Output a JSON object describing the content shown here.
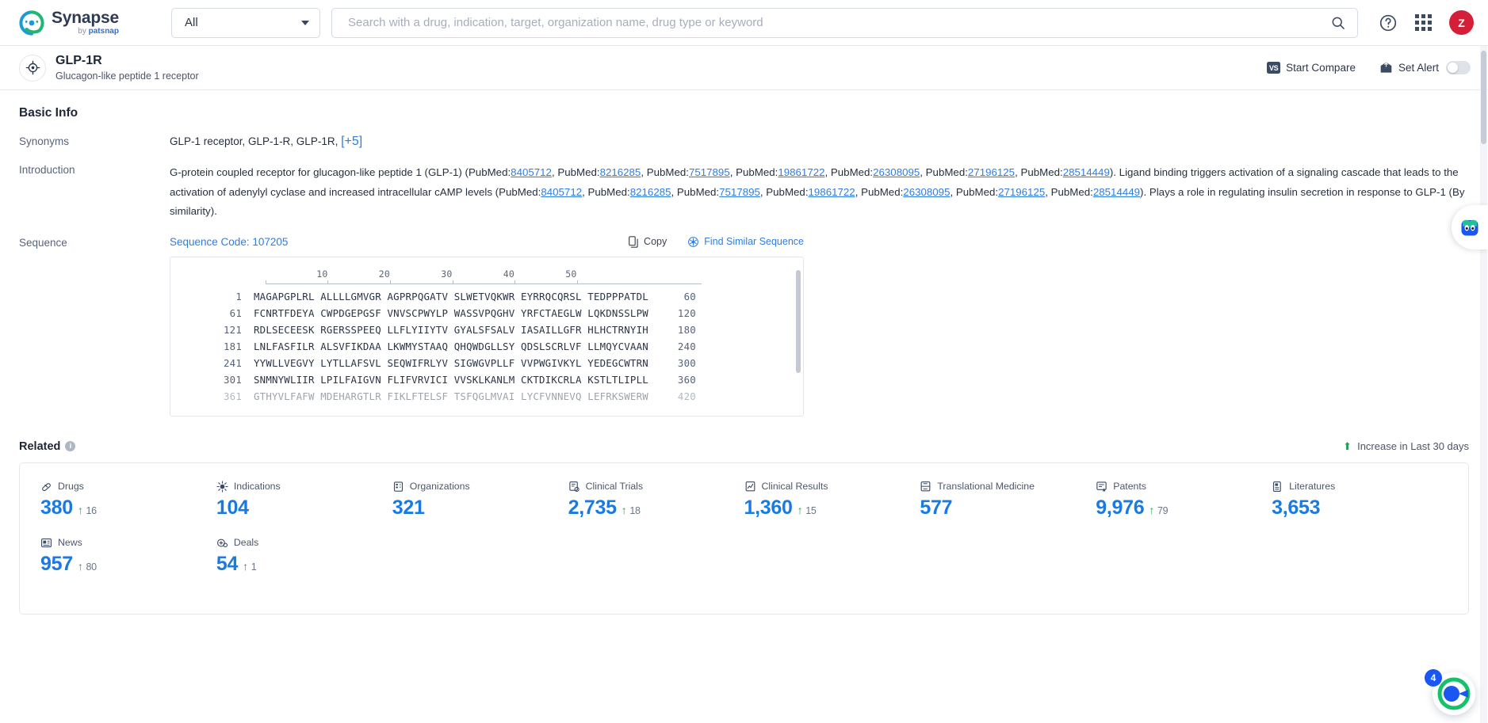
{
  "topbar": {
    "brand_name": "Synapse",
    "brand_sub_prefix": "by ",
    "brand_sub_name": "patsnap",
    "scope_value": "All",
    "scope_icon": "chevron-down-icon",
    "search_value": "",
    "search_placeholder": "Search with a drug, indication, target, organization name, drug type or keyword",
    "search_icon": "search-icon",
    "help_icon": "help-circle-icon",
    "apps_icon": "grid-apps-icon",
    "avatar_initial": "Z",
    "avatar_color": "#d31f38"
  },
  "entity": {
    "icon": "target-crosshair-icon",
    "name": "GLP-1R",
    "subtitle": "Glucagon-like peptide 1 receptor",
    "compare_badge": "VS",
    "compare_label": "Start Compare",
    "alert_icon": "bell-envelope-icon",
    "alert_label": "Set Alert",
    "alert_toggle_on": false
  },
  "basic_info": {
    "title": "Basic Info",
    "synonyms_label": "Synonyms",
    "synonyms": [
      "GLP-1 receptor",
      "GLP-1-R",
      "GLP-1R"
    ],
    "synonyms_more": "[+5]",
    "introduction_label": "Introduction",
    "introduction": {
      "part1": "G-protein coupled receptor for glucagon-like peptide 1 (GLP-1) (PubMed:",
      "refs1": [
        "8405712",
        "8216285",
        "7517895",
        "19861722",
        "26308095",
        "27196125",
        "28514449"
      ],
      "part2": "). Ligand binding triggers activation of a signaling cascade that leads to the activation of adenylyl cyclase and increased intracellular cAMP levels (PubMed:",
      "refs2": [
        "8405712",
        "8216285",
        "7517895",
        "19861722",
        "26308095",
        "27196125",
        "28514449"
      ],
      "part3": "). Plays a role in regulating insulin secretion in response to GLP-1 (By similarity).",
      "separator": ", PubMed:"
    }
  },
  "sequence": {
    "label": "Sequence",
    "code_label": "Sequence Code: 107205",
    "copy_label": "Copy",
    "copy_icon": "copy-icon",
    "similar_label": "Find Similar Sequence",
    "similar_icon": "find-similar-icon",
    "ruler_ticks": [
      "10",
      "20",
      "30",
      "40",
      "50"
    ],
    "rows": [
      {
        "start": "1",
        "blocks": [
          "MAGAPGPLRL",
          "ALLLLGMVGR",
          "AGPRPQGATV",
          "SLWETVQKWR",
          "EYRRQCQRSL",
          "TEDPPPATDL"
        ],
        "end": "60"
      },
      {
        "start": "61",
        "blocks": [
          "FCNRTFDEYA",
          "CWPDGEPGSF",
          "VNVSCPWYLP",
          "WASSVPQGHV",
          "YRFCTAEGLW",
          "LQKDNSSLPW"
        ],
        "end": "120"
      },
      {
        "start": "121",
        "blocks": [
          "RDLSECEESK",
          "RGERSSPEEQ",
          "LLFLYIIYTV",
          "GYALSFSALV",
          "IASAILLGFR",
          "HLHCTRNYIH"
        ],
        "end": "180"
      },
      {
        "start": "181",
        "blocks": [
          "LNLFASFILR",
          "ALSVFIKDAA",
          "LKWMYSTAAQ",
          "QHQWDGLLSY",
          "QDSLSCRLVF",
          "LLMQYCVAAN"
        ],
        "end": "240"
      },
      {
        "start": "241",
        "blocks": [
          "YYWLLVEGVY",
          "LYTLLAFSVL",
          "SEQWIFRLYV",
          "SIGWGVPLLF",
          "VVPWGIVKYL",
          "YEDEGCWTRN"
        ],
        "end": "300"
      },
      {
        "start": "301",
        "blocks": [
          "SNMNYWLIIR",
          "LPILFAIGVN",
          "FLIFVRVICI",
          "VVSKLKANLM",
          "CKTDIKCRLA",
          "KSTLTLIPLL"
        ],
        "end": "360"
      },
      {
        "start": "361",
        "blocks": [
          "GTHYVLFAFW",
          "MDEHARGTLR",
          "FIKLFTELSF",
          "TSFQGLMVAI",
          "LYCFVNNEVQ",
          "LEFRKSWERW"
        ],
        "end": "420"
      }
    ]
  },
  "related": {
    "title": "Related",
    "info_icon": "info-icon",
    "legend_icon": "arrow-up-icon",
    "legend_label": "Increase in Last 30 days",
    "metrics": [
      {
        "icon": "pill-icon",
        "label": "Drugs",
        "value": "380",
        "delta": "16"
      },
      {
        "icon": "virus-icon",
        "label": "Indications",
        "value": "104",
        "delta": ""
      },
      {
        "icon": "building-icon",
        "label": "Organizations",
        "value": "321",
        "delta": ""
      },
      {
        "icon": "clinical-trial-icon",
        "label": "Clinical Trials",
        "value": "2,735",
        "delta": "18"
      },
      {
        "icon": "clinical-result-icon",
        "label": "Clinical Results",
        "value": "1,360",
        "delta": "15"
      },
      {
        "icon": "translational-icon",
        "label": "Translational Medicine",
        "value": "577",
        "delta": ""
      },
      {
        "icon": "patent-icon",
        "label": "Patents",
        "value": "9,976",
        "delta": "79"
      },
      {
        "icon": "literature-icon",
        "label": "Literatures",
        "value": "3,653",
        "delta": ""
      },
      {
        "icon": "news-icon",
        "label": "News",
        "value": "957",
        "delta": "80"
      },
      {
        "icon": "deal-icon",
        "label": "Deals",
        "value": "54",
        "delta": "1"
      }
    ]
  },
  "floaters": {
    "chat_icon": "ai-assistant-icon",
    "fab_icon": "synapse-orb-icon",
    "fab_badge": "4"
  }
}
